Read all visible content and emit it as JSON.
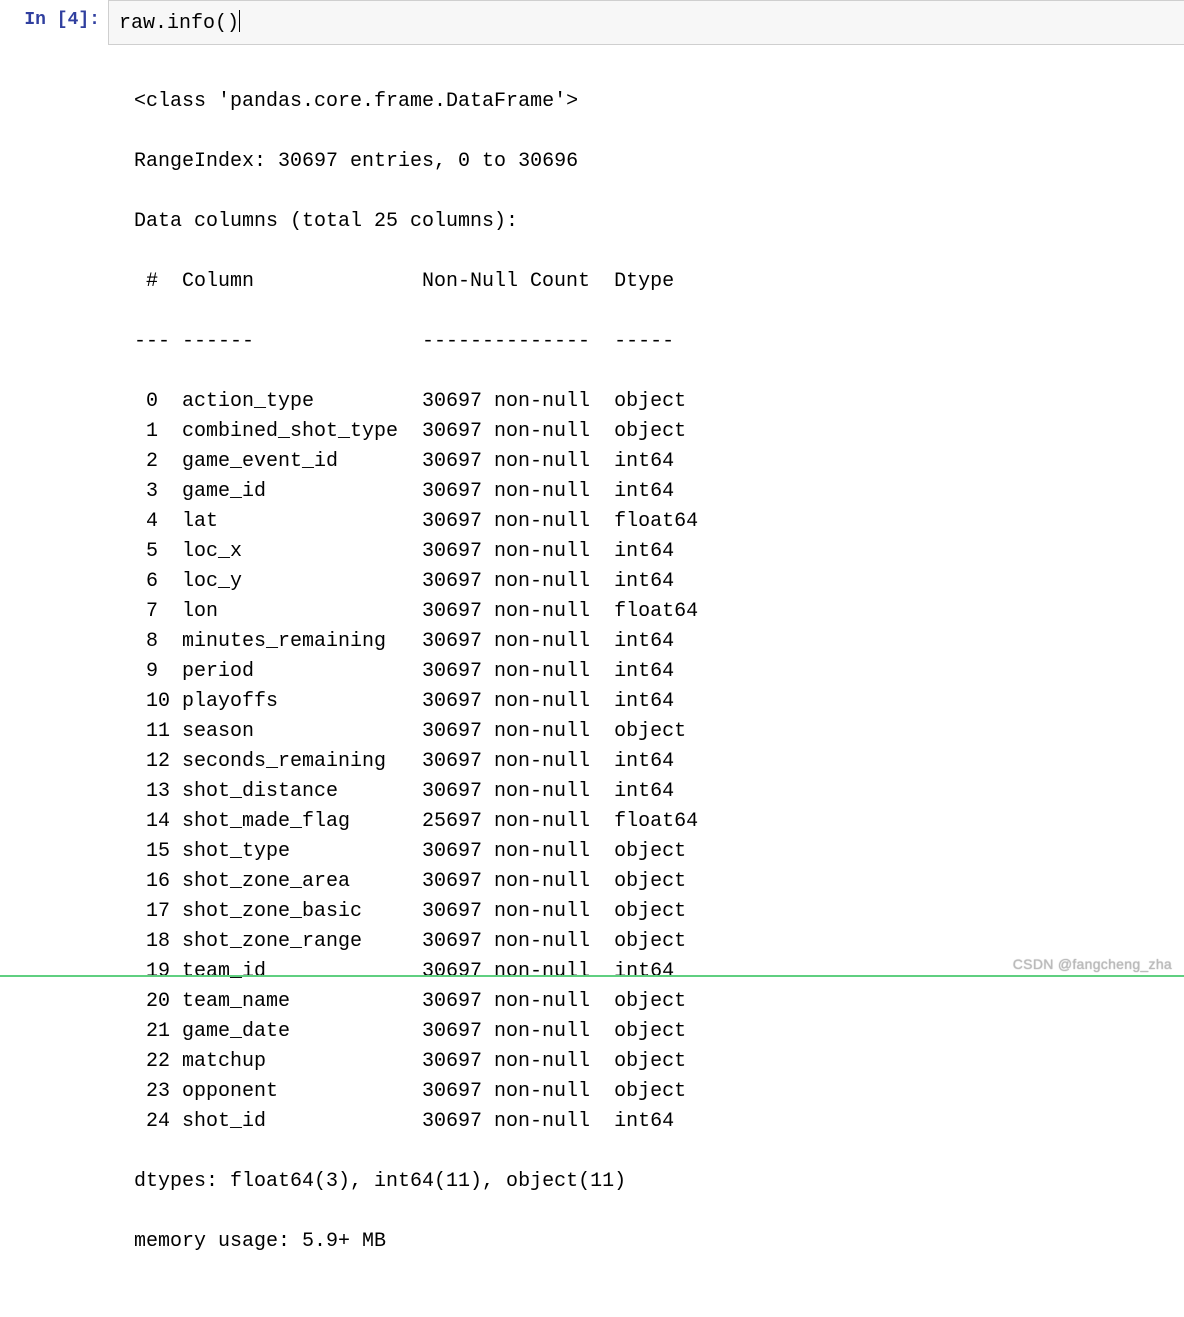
{
  "prompt": "In [4]:",
  "code": "raw.info()",
  "output": {
    "preamble": [
      "<class 'pandas.core.frame.DataFrame'>",
      "RangeIndex: 30697 entries, 0 to 30696",
      "Data columns (total 25 columns):"
    ],
    "header": {
      "num": " #  ",
      "col": "Column",
      "nn": "Non-Null Count",
      "dt": "Dtype"
    },
    "divider": {
      "num": "--- ",
      "col": "------",
      "nn": "--------------",
      "dt": "-----"
    },
    "rows": [
      {
        "idx": " 0  ",
        "col": "action_type",
        "nn": "30697 non-null",
        "dt": "object"
      },
      {
        "idx": " 1  ",
        "col": "combined_shot_type",
        "nn": "30697 non-null",
        "dt": "object"
      },
      {
        "idx": " 2  ",
        "col": "game_event_id",
        "nn": "30697 non-null",
        "dt": "int64"
      },
      {
        "idx": " 3  ",
        "col": "game_id",
        "nn": "30697 non-null",
        "dt": "int64"
      },
      {
        "idx": " 4  ",
        "col": "lat",
        "nn": "30697 non-null",
        "dt": "float64"
      },
      {
        "idx": " 5  ",
        "col": "loc_x",
        "nn": "30697 non-null",
        "dt": "int64"
      },
      {
        "idx": " 6  ",
        "col": "loc_y",
        "nn": "30697 non-null",
        "dt": "int64"
      },
      {
        "idx": " 7  ",
        "col": "lon",
        "nn": "30697 non-null",
        "dt": "float64"
      },
      {
        "idx": " 8  ",
        "col": "minutes_remaining",
        "nn": "30697 non-null",
        "dt": "int64"
      },
      {
        "idx": " 9  ",
        "col": "period",
        "nn": "30697 non-null",
        "dt": "int64"
      },
      {
        "idx": " 10 ",
        "col": "playoffs",
        "nn": "30697 non-null",
        "dt": "int64"
      },
      {
        "idx": " 11 ",
        "col": "season",
        "nn": "30697 non-null",
        "dt": "object"
      },
      {
        "idx": " 12 ",
        "col": "seconds_remaining",
        "nn": "30697 non-null",
        "dt": "int64"
      },
      {
        "idx": " 13 ",
        "col": "shot_distance",
        "nn": "30697 non-null",
        "dt": "int64"
      },
      {
        "idx": " 14 ",
        "col": "shot_made_flag",
        "nn": "25697 non-null",
        "dt": "float64"
      },
      {
        "idx": " 15 ",
        "col": "shot_type",
        "nn": "30697 non-null",
        "dt": "object"
      },
      {
        "idx": " 16 ",
        "col": "shot_zone_area",
        "nn": "30697 non-null",
        "dt": "object"
      },
      {
        "idx": " 17 ",
        "col": "shot_zone_basic",
        "nn": "30697 non-null",
        "dt": "object"
      },
      {
        "idx": " 18 ",
        "col": "shot_zone_range",
        "nn": "30697 non-null",
        "dt": "object"
      },
      {
        "idx": " 19 ",
        "col": "team_id",
        "nn": "30697 non-null",
        "dt": "int64"
      },
      {
        "idx": " 20 ",
        "col": "team_name",
        "nn": "30697 non-null",
        "dt": "object"
      },
      {
        "idx": " 21 ",
        "col": "game_date",
        "nn": "30697 non-null",
        "dt": "object"
      },
      {
        "idx": " 22 ",
        "col": "matchup",
        "nn": "30697 non-null",
        "dt": "object"
      },
      {
        "idx": " 23 ",
        "col": "opponent",
        "nn": "30697 non-null",
        "dt": "object"
      },
      {
        "idx": " 24 ",
        "col": "shot_id",
        "nn": "30697 non-null",
        "dt": "int64"
      }
    ],
    "postamble": [
      "dtypes: float64(3), int64(11), object(11)",
      "memory usage: 5.9+ MB"
    ]
  },
  "watermark": "CSDN @fangcheng_zha"
}
